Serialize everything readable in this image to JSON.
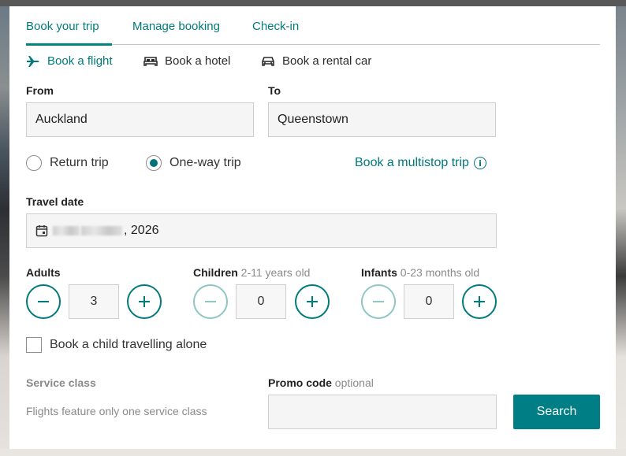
{
  "tabs": [
    {
      "label": "Book your trip",
      "active": true
    },
    {
      "label": "Manage booking",
      "active": false
    },
    {
      "label": "Check-in",
      "active": false
    }
  ],
  "products": [
    {
      "label": "Book a flight",
      "icon": "plane-icon",
      "active": true
    },
    {
      "label": "Book a hotel",
      "icon": "bed-icon",
      "active": false
    },
    {
      "label": "Book a rental car",
      "icon": "car-icon",
      "active": false
    }
  ],
  "route": {
    "from_label": "From",
    "from_value": "Auckland",
    "to_label": "To",
    "to_value": "Queenstown"
  },
  "trip_type": {
    "options": [
      "Return trip",
      "One-way trip"
    ],
    "selected": "One-way trip",
    "multistop_link": "Book a multistop trip"
  },
  "travel_date": {
    "label": "Travel date",
    "value": ", 2026"
  },
  "passengers": {
    "adults": {
      "label": "Adults",
      "sub": "",
      "value": "3"
    },
    "children": {
      "label": "Children",
      "sub": "2-11 years old",
      "value": "0"
    },
    "infants": {
      "label": "Infants",
      "sub": "0-23 months old",
      "value": "0"
    }
  },
  "child_alone": {
    "label": "Book a child travelling alone",
    "checked": false
  },
  "service_class": {
    "label": "Service class",
    "note": "Flights feature only one service class"
  },
  "promo": {
    "label": "Promo code",
    "sub": "optional",
    "value": ""
  },
  "search_button": "Search",
  "colors": {
    "accent": "#007a7a",
    "button": "#007e85"
  }
}
